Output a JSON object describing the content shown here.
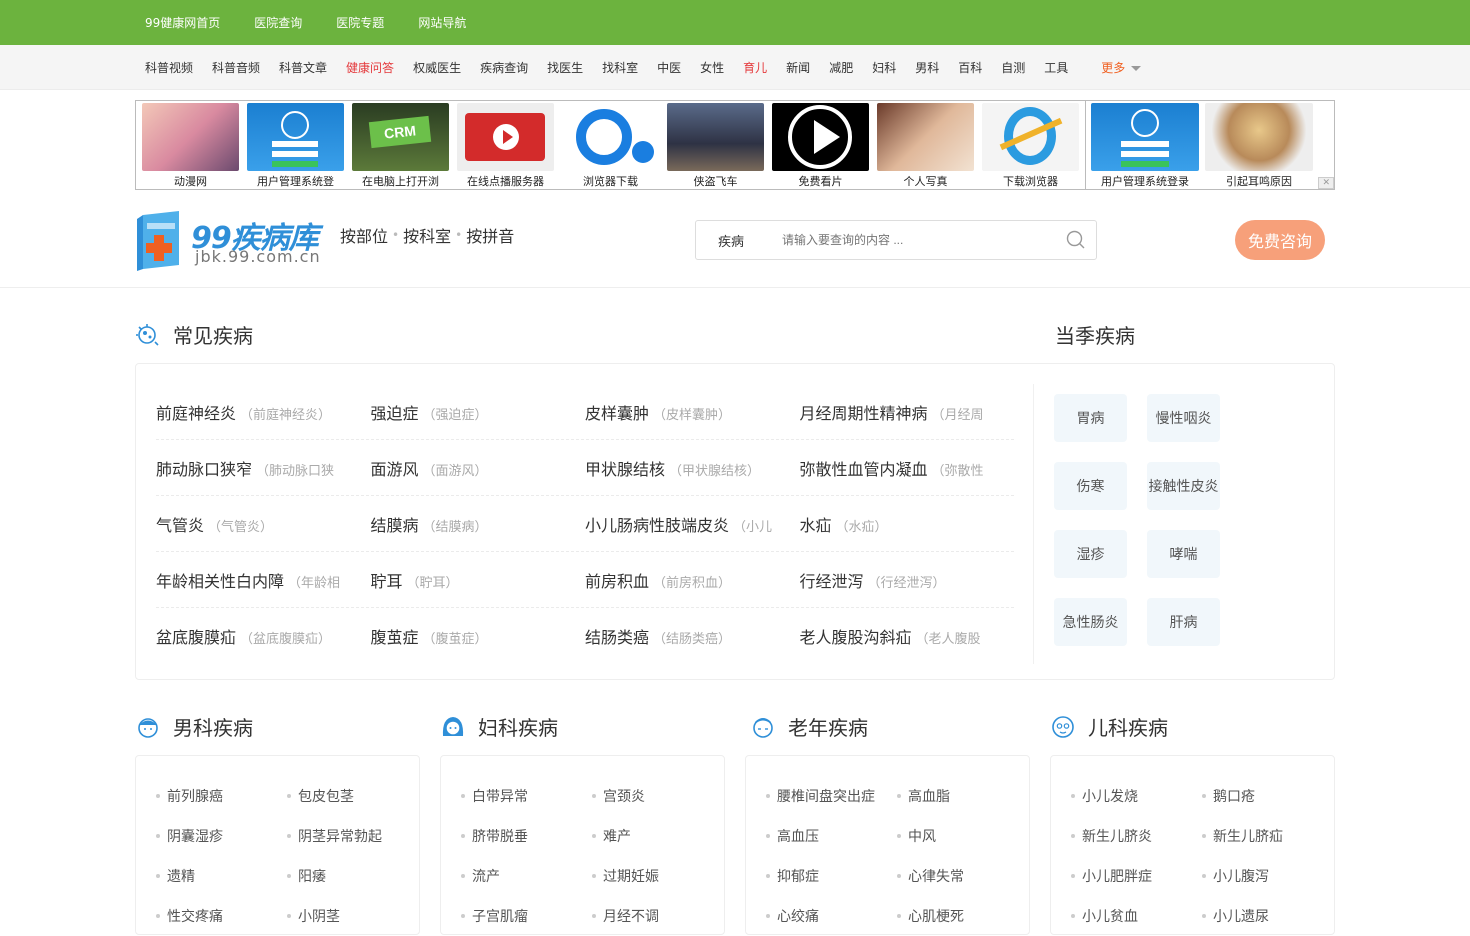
{
  "topnav": [
    "99健康网首页",
    "医院查询",
    "医院专题",
    "网站导航"
  ],
  "catnav": {
    "items": [
      "科普视频",
      "科普音频",
      "科普文章",
      "健康问答",
      "权威医生",
      "疾病查询",
      "找医生",
      "找科室",
      "中医",
      "女性",
      "育儿",
      "新闻",
      "减肥",
      "妇科",
      "男科",
      "百科",
      "自测",
      "工具"
    ],
    "more": "更多"
  },
  "ads": [
    "动漫网",
    "用户管理系统登",
    "在电脑上打开浏",
    "在线点播服务器",
    "浏览器下载",
    "侠盗飞车",
    "免费看片",
    "个人写真",
    "下载浏览器",
    "用户管理系统登录",
    "引起耳鸣原因"
  ],
  "ad_crm_text": "CRM",
  "header": {
    "brand": "99疾病库",
    "domain": "jbk.99.com.cn",
    "by_part": "按部位",
    "by_dept": "按科室",
    "by_pinyin": "按拼音",
    "search_type": "疾病",
    "search_placeholder": "请输入要查询的内容 ...",
    "consult": "免费咨询"
  },
  "common": {
    "title": "常见疾病",
    "rows": [
      [
        {
          "name": "前庭神经炎",
          "alias": "（前庭神经炎）"
        },
        {
          "name": "强迫症",
          "alias": "（强迫症）"
        },
        {
          "name": "皮样囊肿",
          "alias": "（皮样囊肿）"
        },
        {
          "name": "月经周期性精神病",
          "alias": "（月经周"
        }
      ],
      [
        {
          "name": "肺动脉口狭窄",
          "alias": "（肺动脉口狭"
        },
        {
          "name": "面游风",
          "alias": "（面游风）"
        },
        {
          "name": "甲状腺结核",
          "alias": "（甲状腺结核）"
        },
        {
          "name": "弥散性血管内凝血",
          "alias": "（弥散性"
        }
      ],
      [
        {
          "name": "气管炎",
          "alias": "（气管炎）"
        },
        {
          "name": "结膜病",
          "alias": "（结膜病）"
        },
        {
          "name": "小儿肠病性肢端皮炎",
          "alias": "（小儿"
        },
        {
          "name": "水疝",
          "alias": "（水疝）"
        }
      ],
      [
        {
          "name": "年龄相关性白内障",
          "alias": "（年龄相"
        },
        {
          "name": "聍耳",
          "alias": "（聍耳）"
        },
        {
          "name": "前房积血",
          "alias": "（前房积血）"
        },
        {
          "name": "行经泄泻",
          "alias": "（行经泄泻）"
        }
      ],
      [
        {
          "name": "盆底腹膜疝",
          "alias": "（盆底腹膜疝）"
        },
        {
          "name": "腹茧症",
          "alias": "（腹茧症）"
        },
        {
          "name": "结肠类癌",
          "alias": "（结肠类癌）"
        },
        {
          "name": "老人腹股沟斜疝",
          "alias": "（老人腹股"
        }
      ]
    ]
  },
  "seasonal": {
    "title": "当季疾病",
    "tags": [
      "胃病",
      "慢性咽炎",
      "伤寒",
      "接触性皮炎",
      "湿疹",
      "哮喘",
      "急性肠炎",
      "肝病"
    ]
  },
  "categories": [
    {
      "title": "男科疾病",
      "items": [
        "前列腺癌",
        "包皮包茎",
        "阴囊湿疹",
        "阴茎异常勃起",
        "遗精",
        "阳痿",
        "性交疼痛",
        "小阴茎"
      ]
    },
    {
      "title": "妇科疾病",
      "items": [
        "白带异常",
        "宫颈炎",
        "脐带脱垂",
        "难产",
        "流产",
        "过期妊娠",
        "子宫肌瘤",
        "月经不调"
      ]
    },
    {
      "title": "老年疾病",
      "items": [
        "腰椎间盘突出症",
        "高血脂",
        "高血压",
        "中风",
        "抑郁症",
        "心律失常",
        "心绞痛",
        "心肌梗死"
      ]
    },
    {
      "title": "儿科疾病",
      "items": [
        "小儿发烧",
        "鹅口疮",
        "新生儿脐炎",
        "新生儿脐疝",
        "小儿肥胖症",
        "小儿腹泻",
        "小儿贫血",
        "小儿遗尿"
      ]
    }
  ],
  "colors": {
    "green": "#6cb33e",
    "accent": "#f7a07a",
    "brand_blue": "#2f8fd8",
    "highlight": "#e4393c"
  }
}
